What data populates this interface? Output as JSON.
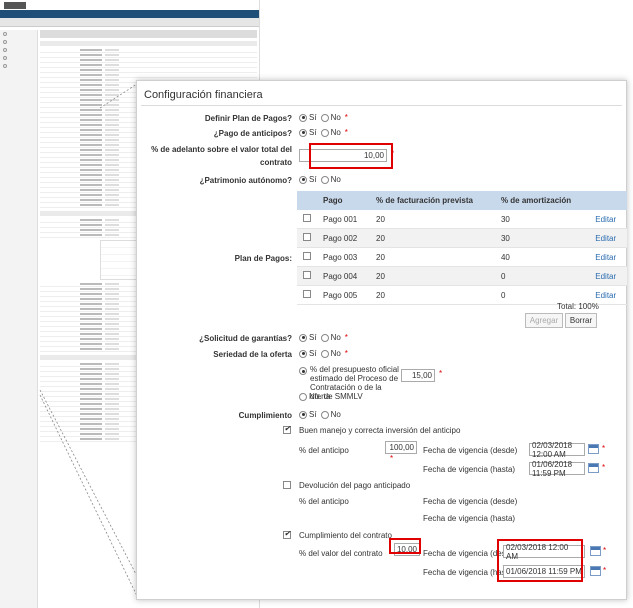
{
  "panel": {
    "title": "Configuración financiera"
  },
  "fields": {
    "plan_pagos": {
      "label": "Definir Plan de Pagos?",
      "si": "Sí",
      "no": "No"
    },
    "anticipos": {
      "label": "¿Pago de anticipos?",
      "si": "Sí",
      "no": "No"
    },
    "adelanto": {
      "label1": "% de adelanto sobre el valor total del",
      "label2": "contrato",
      "value": "10,00"
    },
    "patrimonio": {
      "label": "¿Patrimonio autónomo?",
      "si": "Sí",
      "no": "No"
    },
    "plan_label": "Plan de Pagos:",
    "garantias": {
      "label": "¿Solicitud de garantías?",
      "si": "Sí",
      "no": "No"
    },
    "seriedad": {
      "label": "Seriedad de la oferta",
      "si": "Sí",
      "no": "No",
      "opt1": "% del presupuesto oficial estimado del Proceso de Contratación o de la oferta",
      "opt1_value": "15,00",
      "opt2": "No. de SMMLV"
    },
    "cumplimiento": {
      "label": "Cumplimiento",
      "si": "Sí",
      "no": "No"
    }
  },
  "pagos_table": {
    "headers": [
      "Pago",
      "% de facturación prevista",
      "% de amortización",
      ""
    ],
    "rows": [
      {
        "pago": "Pago 001",
        "fact": "20",
        "amort": "30",
        "action": "Editar"
      },
      {
        "pago": "Pago 002",
        "fact": "20",
        "amort": "30",
        "action": "Editar"
      },
      {
        "pago": "Pago 003",
        "fact": "20",
        "amort": "40",
        "action": "Editar"
      },
      {
        "pago": "Pago 004",
        "fact": "20",
        "amort": "0",
        "action": "Editar"
      },
      {
        "pago": "Pago 005",
        "fact": "20",
        "amort": "0",
        "action": "Editar"
      }
    ],
    "total": "Total: 100%",
    "btn_agregar": "Agregar",
    "btn_borrar": "Borrar"
  },
  "cumplimiento_items": {
    "buen_manejo": {
      "label": "Buen manejo y correcta inversión del anticipo",
      "pct_label": "% del anticipo",
      "pct_value": "100,00",
      "desde_label": "Fecha de vigencia (desde)",
      "desde_value": "02/03/2018 12:00 AM",
      "hasta_label": "Fecha de vigencia (hasta)",
      "hasta_value": "01/06/2018 11:59 PM"
    },
    "devolucion": {
      "label": "Devolución del pago anticipado",
      "pct_label": "% del anticipo",
      "desde_label": "Fecha de vigencia (desde)",
      "hasta_label": "Fecha de vigencia (hasta)"
    },
    "contrato": {
      "label": "Cumplimiento del contrato",
      "pct_label": "% del valor del contrato",
      "pct_value": "10,00",
      "desde_label": "Fecha de vigencia (desde)",
      "desde_value": "02/03/2018 12:00 AM",
      "hasta_label": "Fecha de vigencia (hasta)",
      "hasta_value": "01/06/2018 11:59 PM"
    }
  },
  "colors": {
    "accent_red": "#e00000",
    "table_header": "#c9d9ec",
    "link": "#2b6cb0",
    "nav": "#1f4e79"
  }
}
